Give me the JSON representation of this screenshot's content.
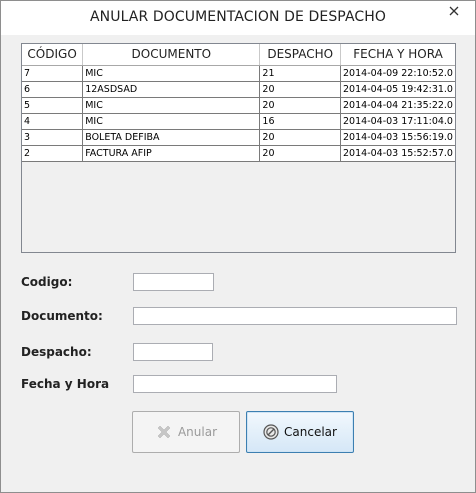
{
  "window": {
    "title": "ANULAR DOCUMENTACION DE DESPACHO",
    "close_icon": "close-icon"
  },
  "table": {
    "columns": [
      "CÓDIGO",
      "DOCUMENTO",
      "DESPACHO",
      "FECHA Y HORA"
    ],
    "rows": [
      {
        "codigo": "7",
        "documento": "MIC",
        "despacho": "21",
        "fecha": "2014-04-09 22:10:52.0"
      },
      {
        "codigo": "6",
        "documento": "12ASDSAD",
        "despacho": "20",
        "fecha": "2014-04-05 19:42:31.0"
      },
      {
        "codigo": "5",
        "documento": "MIC",
        "despacho": "20",
        "fecha": "2014-04-04 21:35:22.0"
      },
      {
        "codigo": "4",
        "documento": "MIC",
        "despacho": "16",
        "fecha": "2014-04-03 17:11:04.0"
      },
      {
        "codigo": "3",
        "documento": "BOLETA DEFIBA",
        "despacho": "20",
        "fecha": "2014-04-03 15:56:19.0"
      },
      {
        "codigo": "2",
        "documento": "FACTURA AFIP",
        "despacho": "20",
        "fecha": "2014-04-03 15:52:57.0"
      }
    ]
  },
  "form": {
    "codigo_label": "Codigo:",
    "codigo_value": "",
    "documento_label": "Documento:",
    "documento_value": "",
    "despacho_label": "Despacho:",
    "despacho_value": "",
    "fecha_label": "Fecha y Hora",
    "fecha_value": ""
  },
  "buttons": {
    "anular_label": "Anular",
    "anular_icon": "x-icon",
    "cancelar_label": "Cancelar",
    "cancelar_icon": "cancel-circle-icon"
  },
  "colors": {
    "accent": "#3c7fb1",
    "disabled_text": "#9a9a9a"
  }
}
